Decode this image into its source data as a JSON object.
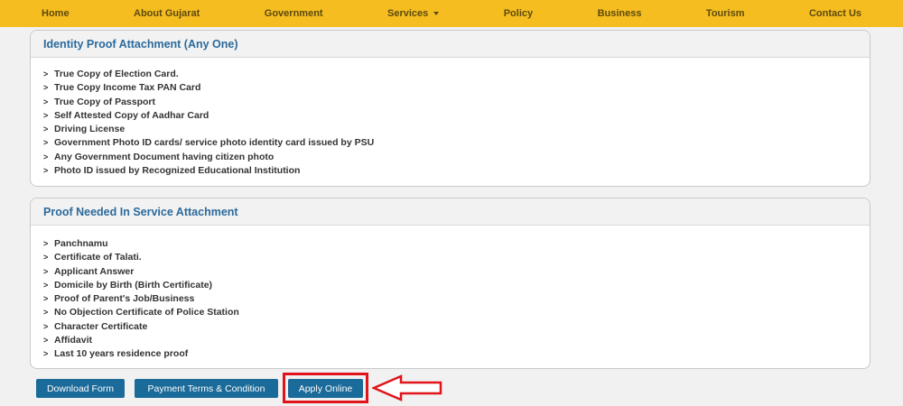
{
  "nav": {
    "items": [
      {
        "label": "Home"
      },
      {
        "label": "About Gujarat"
      },
      {
        "label": "Government"
      },
      {
        "label": "Services",
        "dropdown": true
      },
      {
        "label": "Policy"
      },
      {
        "label": "Business"
      },
      {
        "label": "Tourism"
      },
      {
        "label": "Contact Us"
      }
    ]
  },
  "identity_panel": {
    "title": "Identity Proof Attachment (Any One)",
    "items": [
      "True Copy of Election Card.",
      "True Copy Income Tax PAN Card",
      "True Copy of Passport",
      "Self Attested Copy of Aadhar Card",
      "Driving License",
      "Government Photo ID cards/ service photo identity card issued by PSU",
      "Any Government Document having citizen photo",
      "Photo ID issued by Recognized Educational Institution"
    ]
  },
  "service_panel": {
    "title": "Proof Needed In Service Attachment",
    "items": [
      "Panchnamu",
      "Certificate of Talati.",
      "Applicant Answer",
      "Domicile by Birth (Birth Certificate)",
      "Proof of Parent's Job/Business",
      "No Objection Certificate of Police Station",
      "Character Certificate",
      "Affidavit",
      "Last 10 years residence proof"
    ]
  },
  "actions": {
    "download_label": "Download Form",
    "terms_label": "Payment Terms & Condition",
    "apply_label": "Apply Online"
  },
  "colors": {
    "nav_bg": "#f5bd1f",
    "heading_text": "#2b6a9c",
    "button_bg": "#1a6a9a",
    "highlight": "#e0141a"
  }
}
